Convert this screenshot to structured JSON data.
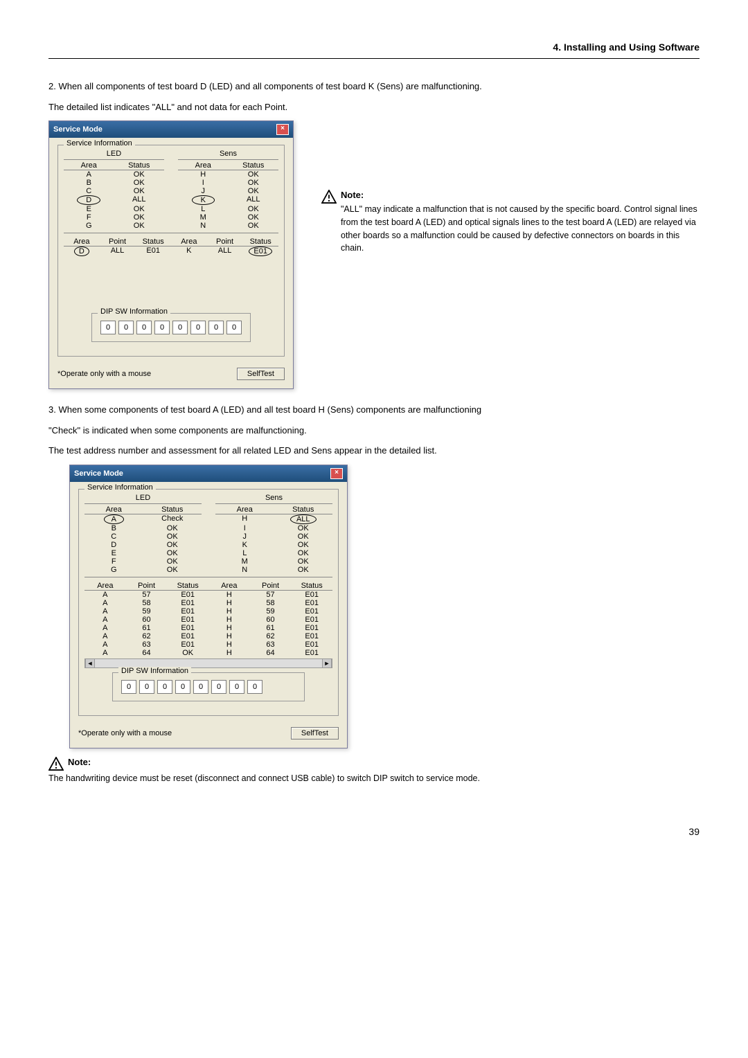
{
  "header": "4. Installing and Using Software",
  "para1_line1": "2.  When all components of test board D (LED) and all components of test board K (Sens) are malfunctioning.",
  "para1_line2": "The detailed list indicates \"ALL\" and not data for each Point.",
  "dialog": {
    "title": "Service Mode",
    "group_si": "Service Information",
    "led_label": "LED",
    "sens_label": "Sens",
    "col_area": "Area",
    "col_status": "Status",
    "col_point": "Point",
    "dip_label": "DIP SW Information",
    "footer_note": "*Operate only with a mouse",
    "selftest": "SelfTest"
  },
  "d1_led": [
    {
      "area": "A",
      "status": "OK"
    },
    {
      "area": "B",
      "status": "OK"
    },
    {
      "area": "C",
      "status": "OK"
    },
    {
      "area": "D",
      "status": "ALL"
    },
    {
      "area": "E",
      "status": "OK"
    },
    {
      "area": "F",
      "status": "OK"
    },
    {
      "area": "G",
      "status": "OK"
    }
  ],
  "d1_sens": [
    {
      "area": "H",
      "status": "OK"
    },
    {
      "area": "I",
      "status": "OK"
    },
    {
      "area": "J",
      "status": "OK"
    },
    {
      "area": "K",
      "status": "ALL"
    },
    {
      "area": "L",
      "status": "OK"
    },
    {
      "area": "M",
      "status": "OK"
    },
    {
      "area": "N",
      "status": "OK"
    }
  ],
  "d1_detail": [
    {
      "a1": "D",
      "p1": "ALL",
      "s1": "E01",
      "a2": "K",
      "p2": "ALL",
      "s2": "E01"
    }
  ],
  "dip": [
    "0",
    "0",
    "0",
    "0",
    "0",
    "0",
    "0",
    "0"
  ],
  "note1_title": "Note:",
  "note1_text": "\"ALL\" may indicate a malfunction that is not caused by the specific board. Control signal lines from the test board A (LED) and optical signals lines to the test board A (LED) are relayed via other boards so a malfunction could be caused by defective connectors on boards in this chain.",
  "para2_line1": "3.  When some components of test board A (LED) and all test board H (Sens) components are malfunctioning",
  "para2_line2": "\"Check\" is indicated when some components are malfunctioning.",
  "para2_line3": "The test address number and assessment for all related LED and Sens appear in the detailed list.",
  "d2_led": [
    {
      "area": "A",
      "status": "Check"
    },
    {
      "area": "B",
      "status": "OK"
    },
    {
      "area": "C",
      "status": "OK"
    },
    {
      "area": "D",
      "status": "OK"
    },
    {
      "area": "E",
      "status": "OK"
    },
    {
      "area": "F",
      "status": "OK"
    },
    {
      "area": "G",
      "status": "OK"
    }
  ],
  "d2_sens": [
    {
      "area": "H",
      "status": "ALL"
    },
    {
      "area": "I",
      "status": "OK"
    },
    {
      "area": "J",
      "status": "OK"
    },
    {
      "area": "K",
      "status": "OK"
    },
    {
      "area": "L",
      "status": "OK"
    },
    {
      "area": "M",
      "status": "OK"
    },
    {
      "area": "N",
      "status": "OK"
    }
  ],
  "d2_detail": [
    {
      "a1": "A",
      "p1": "57",
      "s1": "E01",
      "a2": "H",
      "p2": "57",
      "s2": "E01"
    },
    {
      "a1": "A",
      "p1": "58",
      "s1": "E01",
      "a2": "H",
      "p2": "58",
      "s2": "E01"
    },
    {
      "a1": "A",
      "p1": "59",
      "s1": "E01",
      "a2": "H",
      "p2": "59",
      "s2": "E01"
    },
    {
      "a1": "A",
      "p1": "60",
      "s1": "E01",
      "a2": "H",
      "p2": "60",
      "s2": "E01"
    },
    {
      "a1": "A",
      "p1": "61",
      "s1": "E01",
      "a2": "H",
      "p2": "61",
      "s2": "E01"
    },
    {
      "a1": "A",
      "p1": "62",
      "s1": "E01",
      "a2": "H",
      "p2": "62",
      "s2": "E01"
    },
    {
      "a1": "A",
      "p1": "63",
      "s1": "E01",
      "a2": "H",
      "p2": "63",
      "s2": "E01"
    },
    {
      "a1": "A",
      "p1": "64",
      "s1": "OK",
      "a2": "H",
      "p2": "64",
      "s2": "E01"
    }
  ],
  "note2_title": "Note:",
  "note2_text": "The handwriting device must be reset (disconnect and connect USB cable) to switch DIP switch to service mode.",
  "page_num": "39"
}
